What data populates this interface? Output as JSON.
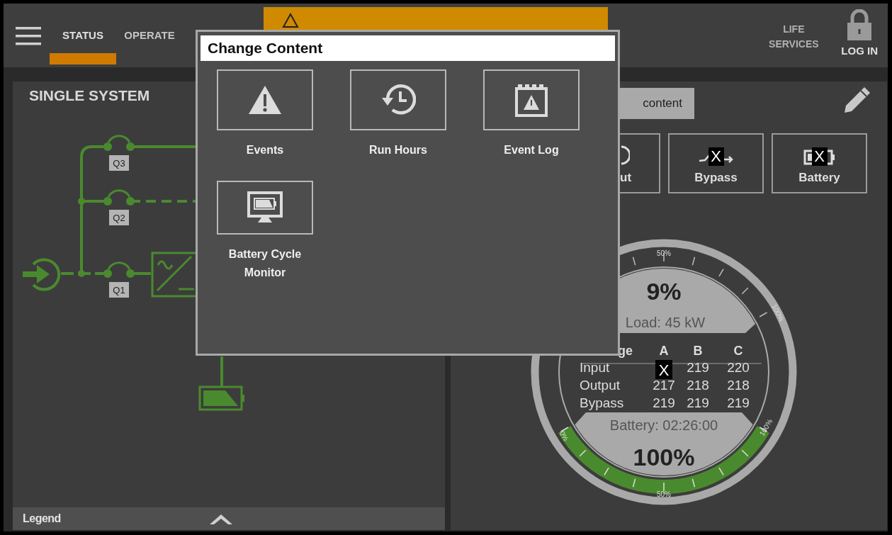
{
  "header": {
    "nav_tabs": [
      {
        "label": "STATUS",
        "selected": true
      },
      {
        "label": "OPERATE",
        "selected": false
      }
    ],
    "life_services": "LIFE SERVICES",
    "login": "LOG IN"
  },
  "left_panel": {
    "title": "SINGLE SYSTEM",
    "switches": [
      {
        "label": "Q3"
      },
      {
        "label": "Q2"
      },
      {
        "label": "Q1"
      }
    ],
    "legend": "Legend"
  },
  "right_panel": {
    "tooltip": "content",
    "tiles": [
      {
        "label": "ut",
        "kind": "output"
      },
      {
        "label": "Bypass",
        "kind": "bypass",
        "mark": "X"
      },
      {
        "label": "Battery",
        "kind": "battery",
        "mark": "X"
      }
    ],
    "gauge": {
      "load_percent": "9%",
      "load": "Load: 45 kW",
      "upper_scale": [
        "50%",
        "100%"
      ],
      "lower_scale": [
        "0%",
        "50%",
        "100%"
      ],
      "battery_arc": {
        "level": 1
      },
      "table": {
        "columns": [
          "ge",
          "A",
          "B",
          "C"
        ],
        "rows": [
          {
            "cells": [
              {
                "text": "Input",
                "kind": "label"
              },
              {
                "text": "X",
                "kind": "redaction"
              },
              {
                "text": "219",
                "kind": "value"
              },
              {
                "text": "220",
                "kind": "value"
              }
            ]
          },
          {
            "cells": [
              {
                "text": "Output",
                "kind": "label"
              },
              {
                "text": "217",
                "kind": "value"
              },
              {
                "text": "218",
                "kind": "value"
              },
              {
                "text": "218",
                "kind": "value"
              }
            ]
          },
          {
            "cells": [
              {
                "text": "Bypass",
                "kind": "label"
              },
              {
                "text": "219",
                "kind": "value"
              },
              {
                "text": "219",
                "kind": "value"
              },
              {
                "text": "219",
                "kind": "value"
              }
            ]
          }
        ]
      },
      "battery_time": "Battery: 02:26:00",
      "battery_percent": "100%"
    }
  },
  "dialog": {
    "title": "Change Content",
    "options": [
      {
        "label": "Events",
        "kind": "events"
      },
      {
        "label": "Run Hours",
        "kind": "run_hours"
      },
      {
        "label": "Event Log",
        "kind": "event_log"
      },
      {
        "label": "Battery Cycle Monitor",
        "kind": "battery_cycle"
      }
    ]
  }
}
